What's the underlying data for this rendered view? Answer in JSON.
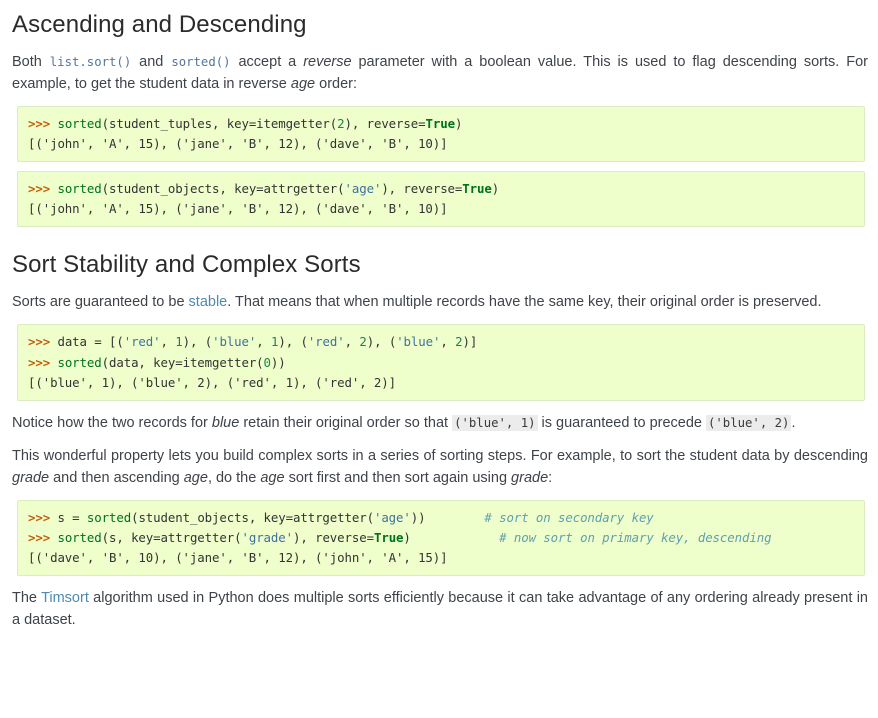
{
  "sections": [
    {
      "heading": "Ascending and Descending",
      "paragraph_parts": {
        "p1_a": "Both ",
        "p1_code1": "list.sort()",
        "p1_b": " and ",
        "p1_code2": "sorted()",
        "p1_c": " accept a ",
        "p1_em1": "reverse",
        "p1_d": " parameter with a boolean value. This is used to flag descending sorts. For example, to get the student data in reverse ",
        "p1_em2": "age",
        "p1_e": " order:"
      }
    },
    {
      "heading": "Sort Stability and Complex Sorts"
    }
  ],
  "code_blocks": {
    "block1": {
      "line1": {
        "prompt": ">>> ",
        "fn": "sorted",
        "open": "(student_tuples, key=itemgetter(",
        "num": "2",
        "mid": "), reverse=",
        "kw": "True",
        "close": ")"
      },
      "line2": "[('john', 'A', 15), ('jane', 'B', 12), ('dave', 'B', 10)]"
    },
    "block2": {
      "line1": {
        "prompt": ">>> ",
        "fn": "sorted",
        "open": "(student_objects, key=attrgetter(",
        "str": "'age'",
        "mid": "), reverse=",
        "kw": "True",
        "close": ")"
      },
      "line2": "[('john', 'A', 15), ('jane', 'B', 12), ('dave', 'B', 10)]"
    },
    "block3": {
      "line1": {
        "prompt": ">>> ",
        "pre": "data = [(",
        "s1": "'red'",
        "t1": ", ",
        "n1": "1",
        "t2": "), (",
        "s2": "'blue'",
        "t3": ", ",
        "n2": "1",
        "t4": "), (",
        "s3": "'red'",
        "t5": ", ",
        "n3": "2",
        "t6": "), (",
        "s4": "'blue'",
        "t7": ", ",
        "n4": "2",
        "t8": ")]"
      },
      "line2": {
        "prompt": ">>> ",
        "fn": "sorted",
        "open": "(data, key=itemgetter(",
        "num": "0",
        "close": "))"
      },
      "line3": "[('blue', 1), ('blue', 2), ('red', 1), ('red', 2)]"
    },
    "block4": {
      "line1": {
        "prompt": ">>> ",
        "pre": "s = ",
        "fn": "sorted",
        "open": "(student_objects, key=attrgetter(",
        "str": "'age'",
        "close": "))",
        "pad": "        ",
        "comment": "# sort on secondary key"
      },
      "line2": {
        "prompt": ">>> ",
        "fn": "sorted",
        "open": "(s, key=attrgetter(",
        "str": "'grade'",
        "mid": "), reverse=",
        "kw": "True",
        "close": ")",
        "pad": "            ",
        "comment": "# now sort on primary key, descending"
      },
      "line3": "[('dave', 'B', 10), ('jane', 'B', 12), ('john', 'A', 15)]"
    }
  },
  "paragraphs": {
    "stability": {
      "a": "Sorts are guaranteed to be ",
      "link": "stable",
      "b": ". That means that when multiple records have the same key, their original order is preserved."
    },
    "notice": {
      "a": "Notice how the two records for ",
      "em": "blue",
      "b": " retain their original order so that ",
      "code1": "('blue', 1)",
      "c": " is guaranteed to precede ",
      "code2": "('blue', 2)",
      "d": "."
    },
    "complex": {
      "a": "This wonderful property lets you build complex sorts in a series of sorting steps. For example, to sort the student data by descending ",
      "em1": "grade",
      "b": " and then ascending ",
      "em2": "age",
      "c": ", do the ",
      "em3": "age",
      "d": " sort first and then sort again using ",
      "em4": "grade",
      "e": ":"
    },
    "timsort": {
      "a": "The ",
      "link": "Timsort",
      "b": " algorithm used in Python does multiple sorts efficiently because it can take advantage of any ordering already present in a dataset."
    }
  },
  "colors": {
    "code_bg": "#eeffcc",
    "code_border": "#dcecc0",
    "prompt": "#c65d09",
    "keyword": "#007020",
    "string": "#4070a0",
    "number": "#208050",
    "comment": "#60a0b0",
    "link": "#4f8ab0",
    "text": "#3e4349"
  }
}
